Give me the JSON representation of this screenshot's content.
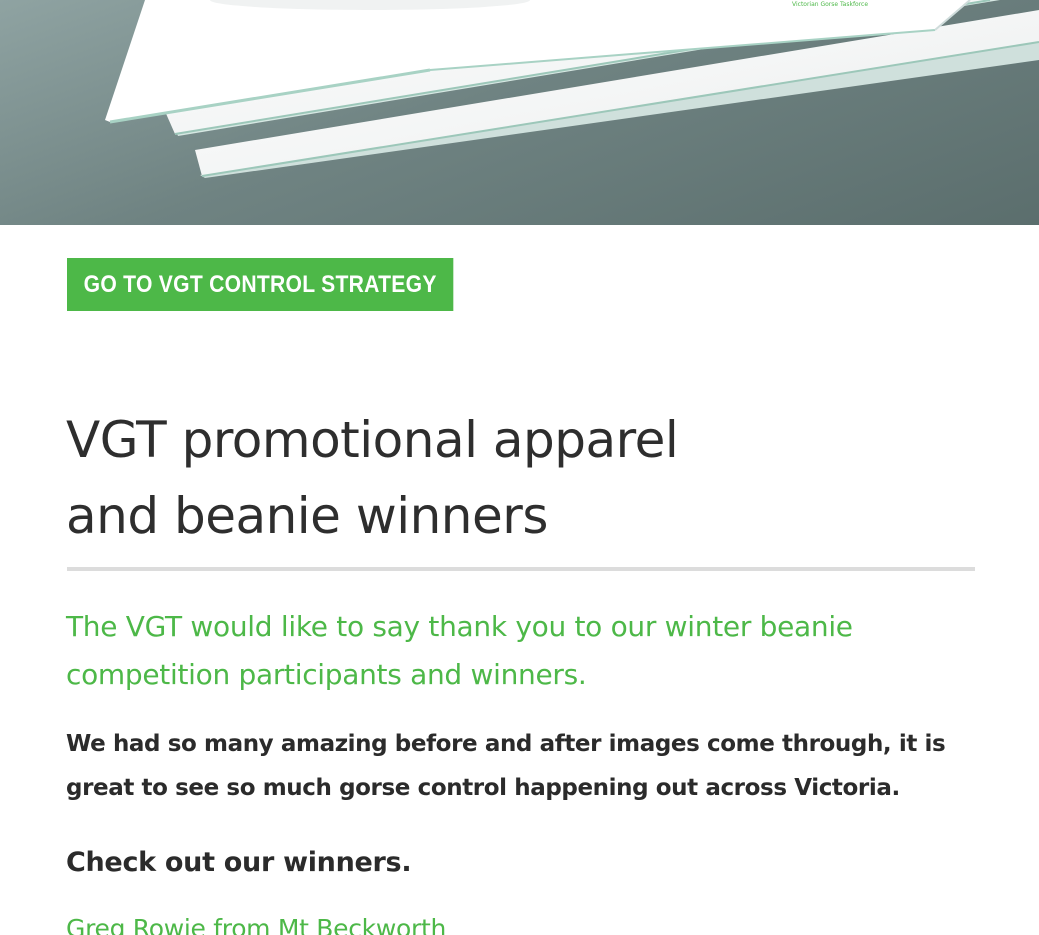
{
  "hero": {
    "image_label": "Victorian Gorse Taskforce"
  },
  "cta": {
    "label": "GO TO VGT CONTROL STRATEGY"
  },
  "article": {
    "title_line1": "VGT promotional apparel",
    "title_line2": "and beanie winners",
    "lead": "The VGT would like to say thank you to our winter beanie competition participants and winners.",
    "body": "We had so many amazing before and after images come through, it is great to see so much gorse control happening out across Victoria.",
    "subhead": "Check out our winners.",
    "winners": [
      "Greg Rowie from Mt Beckworth"
    ]
  },
  "colors": {
    "accent": "#4db848",
    "text": "#2b2b2b",
    "divider": "#dcdcdc",
    "hero_bg": "#6f8382"
  }
}
